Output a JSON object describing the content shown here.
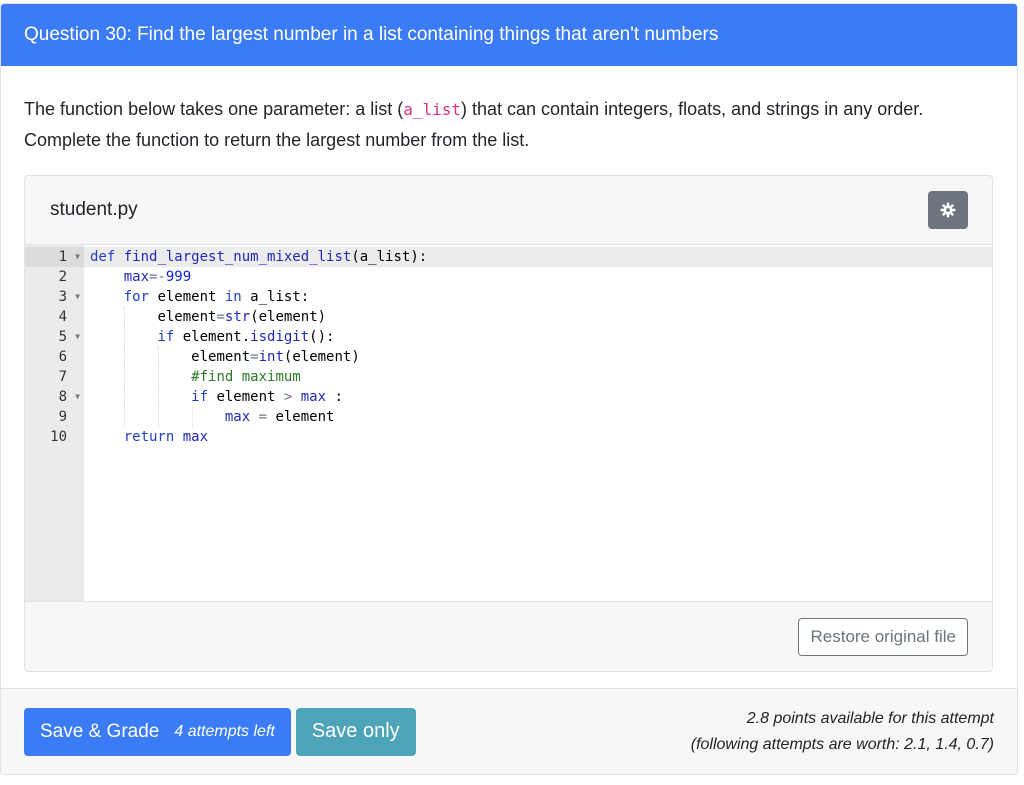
{
  "question": {
    "title": "Question 30: Find the largest number in a list containing things that aren't numbers",
    "prompt_before": "The function below takes one parameter: a list (",
    "prompt_code": "a_list",
    "prompt_after": ") that can contain integers, floats, and strings in any order. Complete the function to return the largest number from the list."
  },
  "file": {
    "name": "student.py",
    "settings_icon": "gear-icon",
    "restore_label": "Restore original file",
    "line_numbers": [
      "1",
      "2",
      "3",
      "4",
      "5",
      "6",
      "7",
      "8",
      "9",
      "10"
    ]
  },
  "code": {
    "l1_kw": "def",
    "l1_fn": "find_largest_num_mixed_list",
    "l1_rest": "(a_list):",
    "l2_var": "max",
    "l2_op": "=-",
    "l2_num": "999",
    "l3_kw": "for",
    "l3_a": " element ",
    "l3_in": "in",
    "l3_b": " a_list:",
    "l4_a": "element",
    "l4_op": "=",
    "l4_fn": "str",
    "l4_b": "(element)",
    "l5_kw": "if",
    "l5_a": " element.",
    "l5_fn": "isdigit",
    "l5_b": "():",
    "l6_a": "element",
    "l6_op": "=",
    "l6_fn": "int",
    "l6_b": "(element)",
    "l7_cmt": "#find maximum",
    "l8_kw": "if",
    "l8_a": " element ",
    "l8_op": ">",
    "l8_var": " max",
    "l8_b": " :",
    "l9_var": "max",
    "l9_op": " = ",
    "l9_b": "element",
    "l10_kw": "return",
    "l10_var": " max"
  },
  "footer": {
    "save_grade_label": "Save & Grade",
    "attempts_left": "4 attempts left",
    "save_only_label": "Save only",
    "points_line1": "2.8 points available for this attempt",
    "points_line2": "(following attempts are worth: 2.1, 1.4, 0.7)"
  },
  "colors": {
    "header_bg": "#3b7cf6",
    "primary": "#3b7cf6",
    "info": "#4da3b8",
    "secondary": "#6c757d"
  }
}
